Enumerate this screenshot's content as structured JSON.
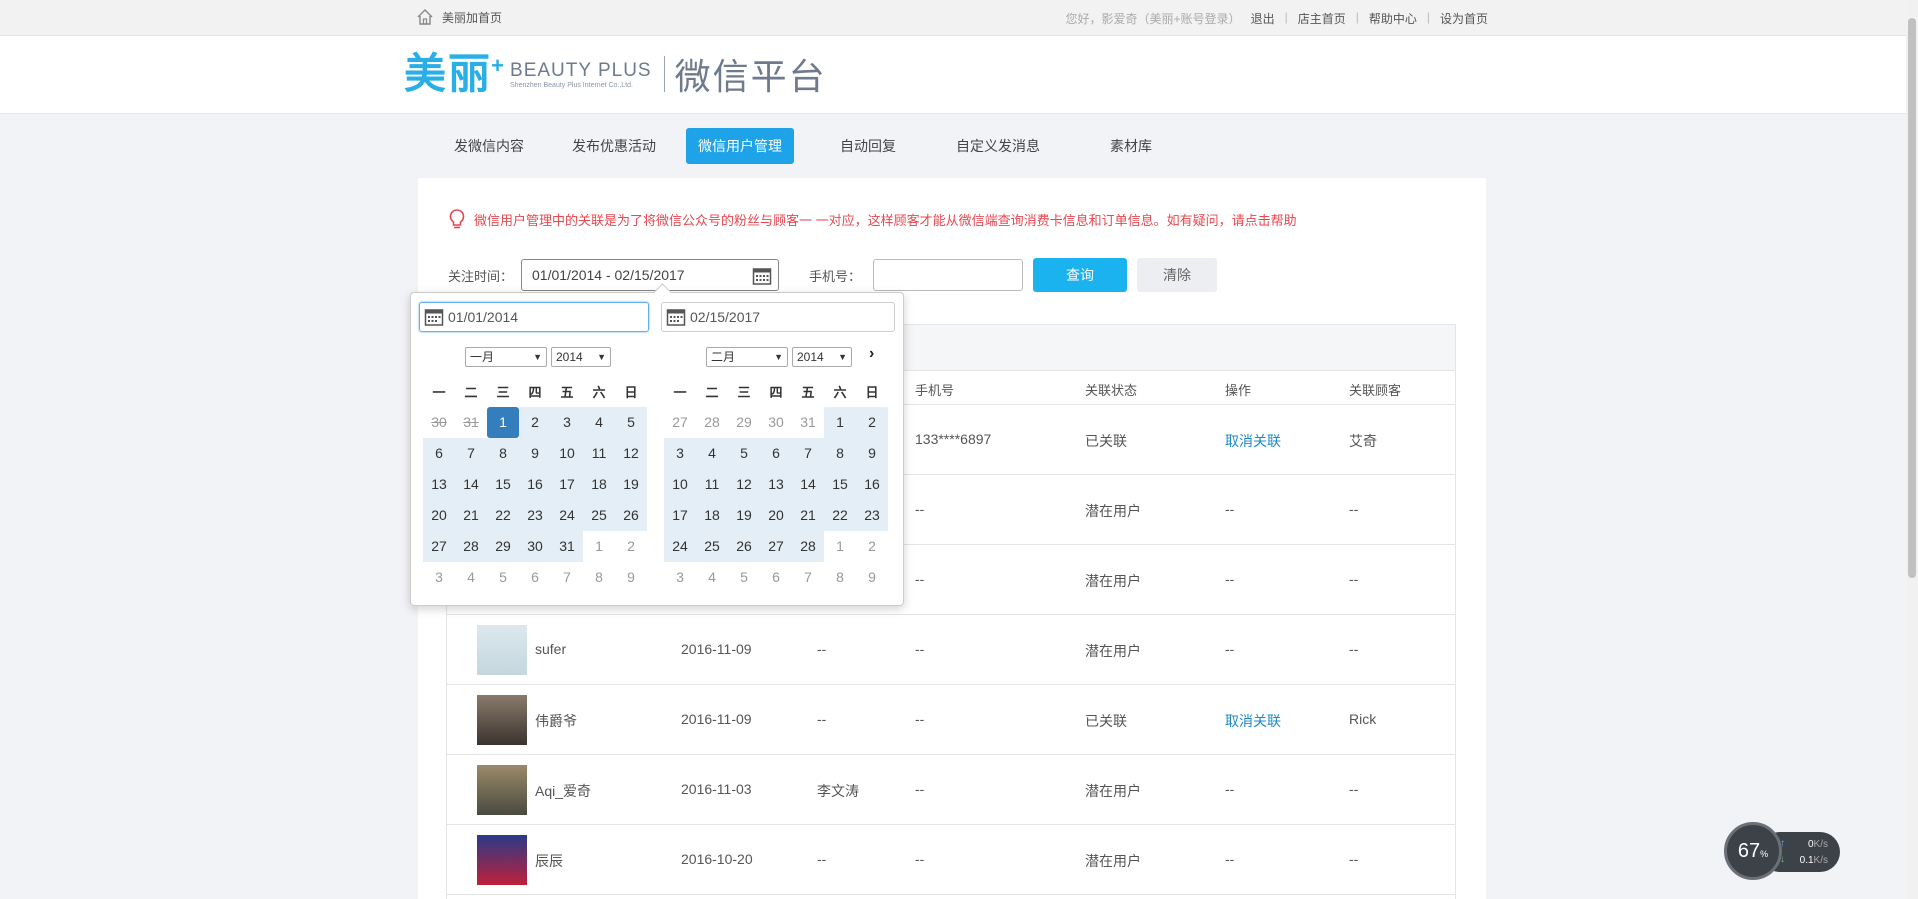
{
  "topbar": {
    "home_label": "美丽加首页",
    "greeting": "您好，影爱奇（美丽+账号登录）",
    "logout": "退出",
    "shop_home": "店主首页",
    "help": "帮助中心",
    "set_home": "设为首页"
  },
  "logo": {
    "cn": "美丽",
    "plus": "+",
    "en": "BEAUTY PLUS",
    "en_sub": "Shenzhen Beauty Plus Internet Co.,Ltd.",
    "platform": "微信平台"
  },
  "nav": [
    {
      "label": "发微信内容",
      "active": false
    },
    {
      "label": "发布优惠活动",
      "active": false
    },
    {
      "label": "微信用户管理",
      "active": true
    },
    {
      "label": "自动回复",
      "active": false
    },
    {
      "label": "自定义发消息",
      "active": false
    },
    {
      "label": "素材库",
      "active": false
    }
  ],
  "notice": "微信用户管理中的关联是为了将微信公众号的粉丝与顾客一 一对应，这样顾客才能从微信端查询消费卡信息和订单信息。如有疑问，请点击帮助",
  "filters": {
    "follow_time_label": "关注时间：",
    "date_range": "01/01/2014 - 02/15/2017",
    "phone_label": "手机号：",
    "phone_value": "",
    "query": "查询",
    "clear": "清除"
  },
  "table": {
    "headers": {
      "phone": "手机号",
      "status": "关联状态",
      "action": "操作",
      "customer": "关联顾客"
    },
    "rows": [
      {
        "name": "",
        "date": "",
        "remark": "",
        "phone": "133****6897",
        "status": "已关联",
        "action": "取消关联",
        "customer": "艾奇"
      },
      {
        "name": "",
        "date": "",
        "remark": "",
        "phone": "--",
        "status": "潜在用户",
        "action": "--",
        "customer": "--"
      },
      {
        "name": "",
        "date": "",
        "remark": "",
        "phone": "--",
        "status": "潜在用户",
        "action": "--",
        "customer": "--"
      },
      {
        "name": "sufer",
        "date": "2016-11-09",
        "remark": "--",
        "phone": "--",
        "status": "潜在用户",
        "action": "--",
        "customer": "--"
      },
      {
        "name": "伟爵爷",
        "date": "2016-11-09",
        "remark": "--",
        "phone": "--",
        "status": "已关联",
        "action": "取消关联",
        "customer": "Rick"
      },
      {
        "name": "Aqi_爱奇",
        "date": "2016-11-03",
        "remark": "李文涛",
        "phone": "--",
        "status": "潜在用户",
        "action": "--",
        "customer": "--"
      },
      {
        "name": "辰辰",
        "date": "2016-10-20",
        "remark": "--",
        "phone": "--",
        "status": "潜在用户",
        "action": "--",
        "customer": "--"
      }
    ]
  },
  "datepicker": {
    "start_input": "01/01/2014",
    "end_input": "02/15/2017",
    "weekdays": [
      "一",
      "二",
      "三",
      "四",
      "五",
      "六",
      "日"
    ],
    "left": {
      "month": "一月",
      "year": "2014",
      "days": [
        "30",
        "31",
        "1",
        "2",
        "3",
        "4",
        "5",
        "6",
        "7",
        "8",
        "9",
        "10",
        "11",
        "12",
        "13",
        "14",
        "15",
        "16",
        "17",
        "18",
        "19",
        "20",
        "21",
        "22",
        "23",
        "24",
        "25",
        "26",
        "27",
        "28",
        "29",
        "30",
        "31",
        "1",
        "2",
        "3",
        "4",
        "5",
        "6",
        "7",
        "8",
        "9"
      ]
    },
    "right": {
      "month": "二月",
      "year": "2014",
      "days": [
        "27",
        "28",
        "29",
        "30",
        "31",
        "1",
        "2",
        "3",
        "4",
        "5",
        "6",
        "7",
        "8",
        "9",
        "10",
        "11",
        "12",
        "13",
        "14",
        "15",
        "16",
        "17",
        "18",
        "19",
        "20",
        "21",
        "22",
        "23",
        "24",
        "25",
        "26",
        "27",
        "28",
        "1",
        "2",
        "3",
        "4",
        "5",
        "6",
        "7",
        "8",
        "9"
      ]
    }
  },
  "speed_widget": {
    "percent": "67",
    "percent_unit": "%",
    "up": "0",
    "up_unit": "K/s",
    "down": "0.1",
    "down_unit": "K/s"
  }
}
